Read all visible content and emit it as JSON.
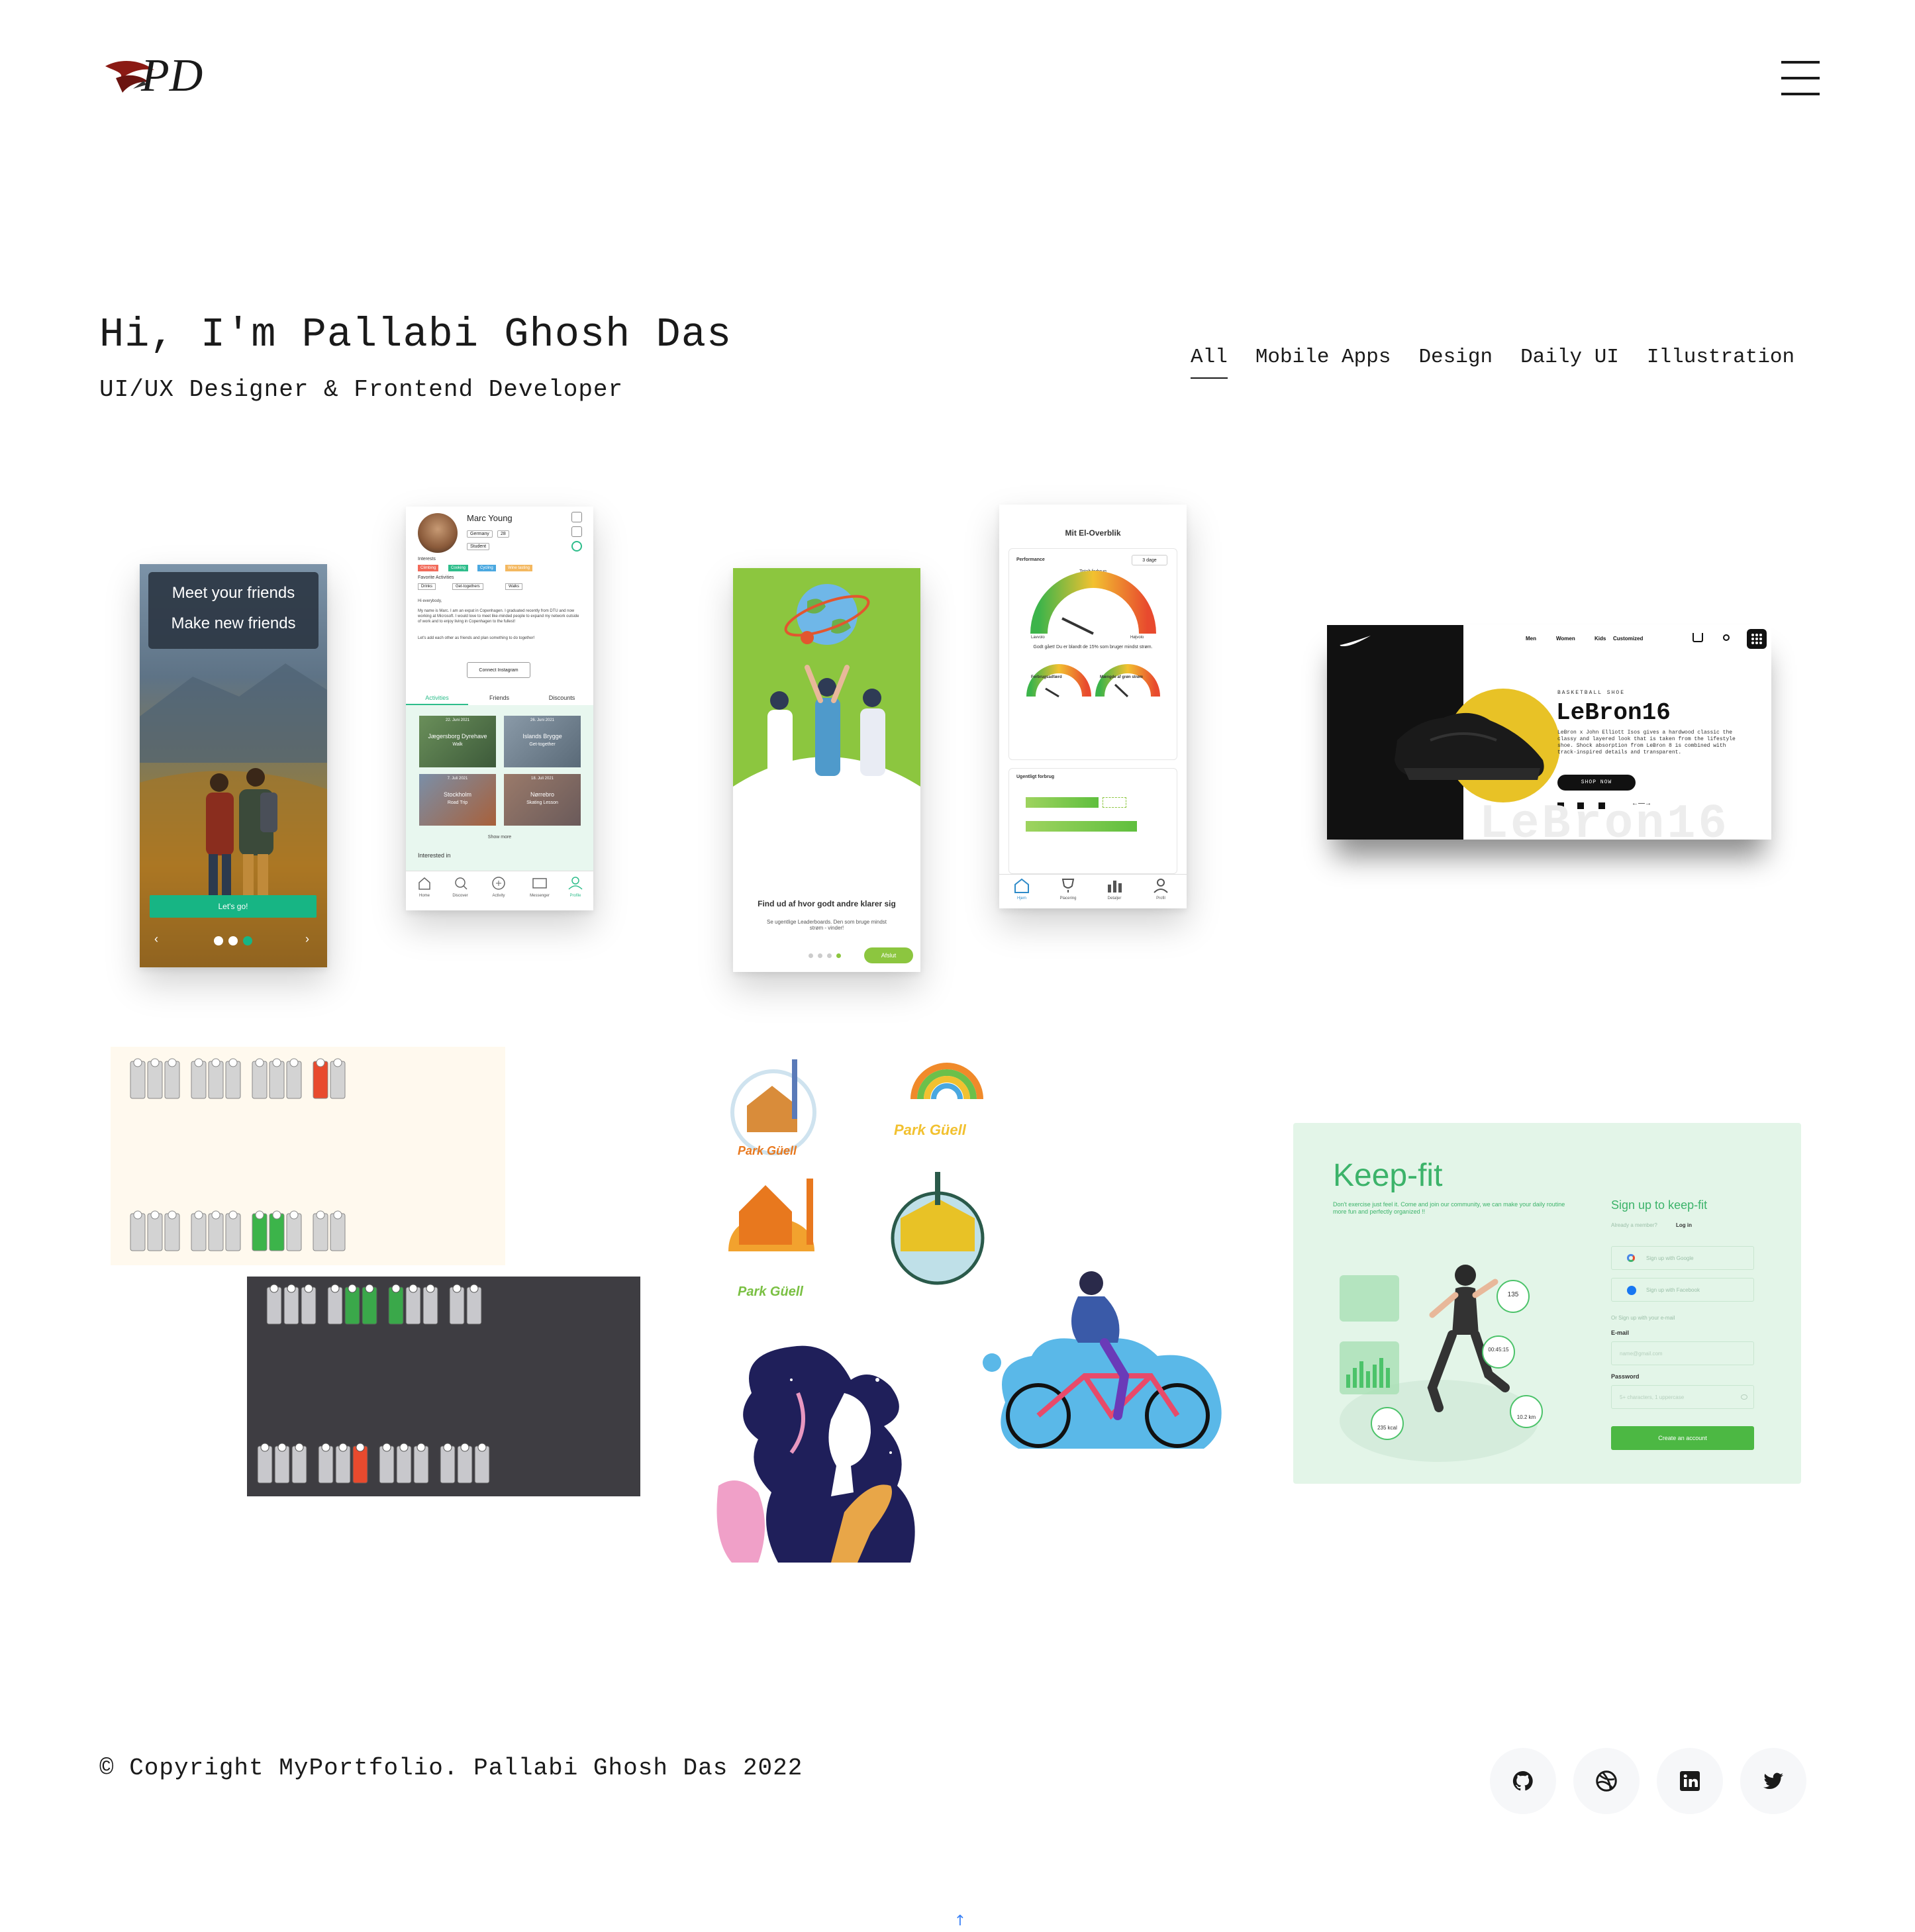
{
  "header": {
    "logo_text": "PD",
    "menu_icon": "hamburger-menu-icon"
  },
  "hero": {
    "title": "Hi, I'm Pallabi Ghosh Das",
    "subtitle": "UI/UX Designer & Frontend Developer"
  },
  "filters": [
    "All",
    "Mobile Apps",
    "Design",
    "Daily UI",
    "Illustration"
  ],
  "active_filter": "All",
  "projects": {
    "friends_app": {
      "line1": "Meet your friends",
      "line2": "Make new friends",
      "cta": "Let's go!"
    },
    "profile_app": {
      "name": "Marc Young",
      "tags": [
        "Germany",
        "28",
        "Student"
      ],
      "interests_label": "Interests",
      "interests": [
        "Climbing",
        "Cooking",
        "Cycling",
        "Wine tasting"
      ],
      "fav_label": "Favorite Activities",
      "favs": [
        "Drinks",
        "Get-togethers",
        "Walks"
      ],
      "bio_greeting": "Hi everybody,",
      "bio": "My name is Marc. I am an expat in Copenhagen. I graduated recently from DTU and now working at Microsoft. I would love to meet like-minded people to expand my network outside of work and to enjoy living in Copenhagen to the fullest!",
      "bio2": "Let's add each other as friends and plan something to do together!",
      "connect": "Connect Instagram",
      "tabs": [
        "Activities",
        "Friends",
        "Discounts"
      ],
      "tiles": [
        {
          "date": "22. Juni 2021",
          "title": "Jægersborg Dyrehave",
          "sub": "Walk"
        },
        {
          "date": "26. Juni 2021",
          "title": "Islands Brygge",
          "sub": "Get-together"
        },
        {
          "date": "7. Juli 2021",
          "title": "Stockholm",
          "sub": "Road Trip"
        },
        {
          "date": "18. Juli 2021",
          "title": "Nørrebro",
          "sub": "Skating Lesson"
        }
      ],
      "show_more": "Show more",
      "interested_in": "Interested in",
      "nav": [
        "Home",
        "Discover",
        "Activity",
        "Messenger",
        "Profile"
      ]
    },
    "onboarding": {
      "heading": "Find ud af hvor godt andre klarer sig",
      "body": "Se ugentlige Leaderboards. Den som bruge mindst strøm - vinder!",
      "button": "Afslut"
    },
    "energy": {
      "title": "Mit El-Overblik",
      "performance": "Performance",
      "period": "3 dage",
      "total": "Totalt forbrug",
      "low": "Lavvolo",
      "high": "Højvolo",
      "summary": "Godt gået! Du er blandt de 15% som bruger mindst strøm.",
      "g2": "Forbrugsadfærd",
      "g3": "Mængde af grøn strøm",
      "weekly": "Ugentligt forbrug",
      "nav": [
        "Hjem",
        "Placering",
        "Detaljer",
        "Profil"
      ]
    },
    "nike": {
      "menu": [
        "Men",
        "Women",
        "Kids",
        "Customized"
      ],
      "eyebrow": "BASKETBALL SHOE",
      "title": "LeBron16",
      "desc": "LeBron x John Elliott Isos gives a hardwood classic the classy and layered look that is taken from the lifestyle shoe. Shock absorption from LeBron 8 is combined with track-inspired details and transparent.",
      "cta": "SHOP NOW",
      "watermark": "LeBron16"
    },
    "park_guell": {
      "label": "Park Güell"
    },
    "keepfit": {
      "brand": "Keep-fit",
      "tagline": "Don't exercise just feel it. Come and join our community, we can make your daily routine more fun and perfectly organized !!",
      "signup_title": "Sign up to keep-fit",
      "member": "Already a member?",
      "login": "Log in",
      "google": "Sign up with Google",
      "facebook": "Sign up with Facebook",
      "or_email": "Or Sign up with your e-mail",
      "email_label": "E-mail",
      "email_ph": "name@gmail.com",
      "password_label": "Password",
      "password_ph": "5+ characters, 1 uppercase",
      "create": "Create an account",
      "stats": [
        "135",
        "00:45:15",
        "10.2 km",
        "235 kcal"
      ]
    }
  },
  "footer": {
    "copyright": "© Copyright MyPortfolio. Pallabi Ghosh Das 2022",
    "socials": [
      "github-icon",
      "dribbble-icon",
      "linkedin-icon",
      "twitter-icon"
    ],
    "back_to_top": "↑"
  },
  "colors": {
    "text": "#1a1a1a",
    "green": "#8cc63f",
    "teal": "#2ebd8b",
    "keepfit_bg": "#e3f5e8",
    "dark_panel": "#3e3d42",
    "red": "#e64a2e",
    "accent_blue": "#3b82f6"
  }
}
